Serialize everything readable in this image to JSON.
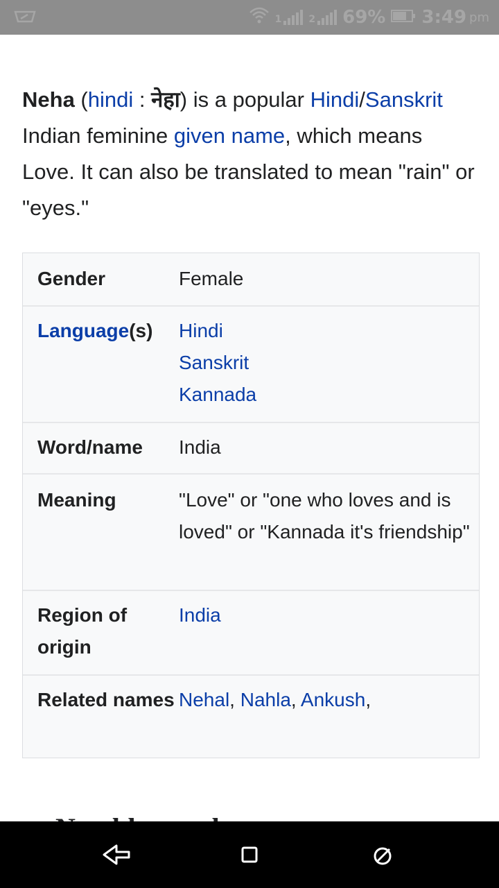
{
  "status_bar": {
    "battery": "69%",
    "time": "3:49",
    "ampm": "pm",
    "network_left": "1",
    "network_right": "2"
  },
  "article": {
    "intro": {
      "name": "Neha",
      "open_paren": " (",
      "lang_link": "hindi",
      "colon": " : ",
      "devanagari": "नेहा",
      "after_dev": ") is a popular ",
      "link_hindi": "Hindi",
      "slash": "/",
      "link_sanskrit": "Sanskrit",
      "text2": " Indian feminine ",
      "link_given_name": "given name",
      "text3": ", which means Love. It can also be translated to mean \"rain\" or \"eyes.\""
    }
  },
  "infobox": {
    "gender": {
      "label": "Gender",
      "value": "Female"
    },
    "language": {
      "label_link": "Language",
      "label_suffix": "(s)",
      "values": [
        "Hindi",
        "Sanskrit",
        "Kannada"
      ]
    },
    "word_name": {
      "label": "Word/name",
      "value": "India"
    },
    "meaning": {
      "label": "Meaning",
      "value": "\"Love\" or \"one who loves and is loved\" or \"Kannada it's friendship\""
    },
    "region": {
      "label": "Region of origin",
      "value": "India"
    },
    "related": {
      "label": "Related names",
      "links": [
        "Nehal",
        "Nahla",
        "Ankush"
      ],
      "separator": ", ",
      "trailing": ","
    }
  },
  "next_heading_partial": "Notable people",
  "colors": {
    "link": "#0b3ea8",
    "text": "#202122",
    "infobox_bg": "#f8f9fa",
    "statusbar": "#8d8d8d"
  }
}
